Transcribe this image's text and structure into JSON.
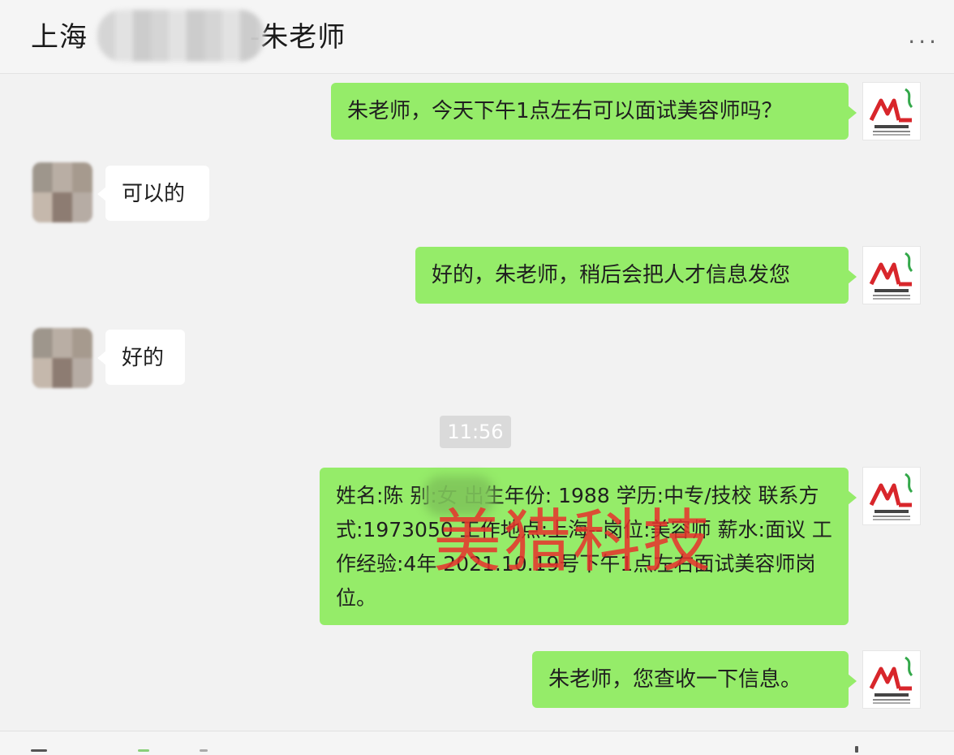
{
  "header": {
    "title_start": "上海",
    "title_end": "-朱老师",
    "more_label": "..."
  },
  "messages": [
    {
      "direction": "out",
      "text": "朱老师，今天下午1点左右可以面试美容师吗？"
    },
    {
      "direction": "in",
      "text": "可以的"
    },
    {
      "direction": "out",
      "text": "好的，朱老师，稍后会把人才信息发您"
    },
    {
      "direction": "in",
      "text": "好的"
    },
    {
      "direction": "out",
      "text": "姓名:陈 别:女 出生年份: 1988 学历:中专/技校 联系方式:1973050 工作地点:上海--岗位:美容师 薪水:面议 工作经验:4年 2021.10.19号下午1点左右面试美容师岗位。"
    },
    {
      "direction": "out",
      "text": "朱老师，您查收一下信息。"
    }
  ],
  "timestamp": "11:56",
  "watermark": "美猎科技",
  "colors": {
    "outgoing_bubble": "#95ec69",
    "incoming_bubble": "#ffffff",
    "background": "#f2f2f2",
    "watermark": "#e8322c"
  }
}
